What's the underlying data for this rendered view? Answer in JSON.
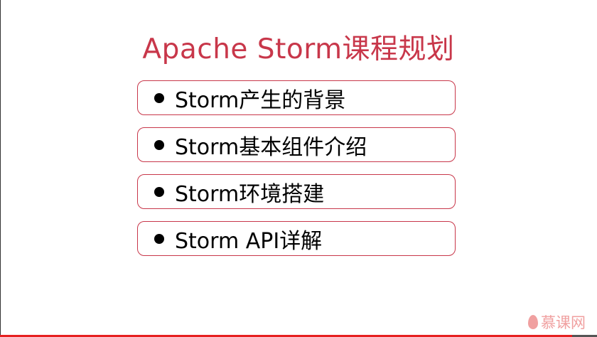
{
  "slide": {
    "title": "Apache Storm课程规划",
    "items": [
      {
        "label": "Storm产生的背景"
      },
      {
        "label": "Storm基本组件介绍"
      },
      {
        "label": "Storm环境搭建"
      },
      {
        "label": "Storm API详解"
      }
    ],
    "accent_color": "#c8374a"
  },
  "watermark": {
    "text": "慕课网",
    "icon": "flame-icon"
  },
  "progress": {
    "percent": 96
  }
}
